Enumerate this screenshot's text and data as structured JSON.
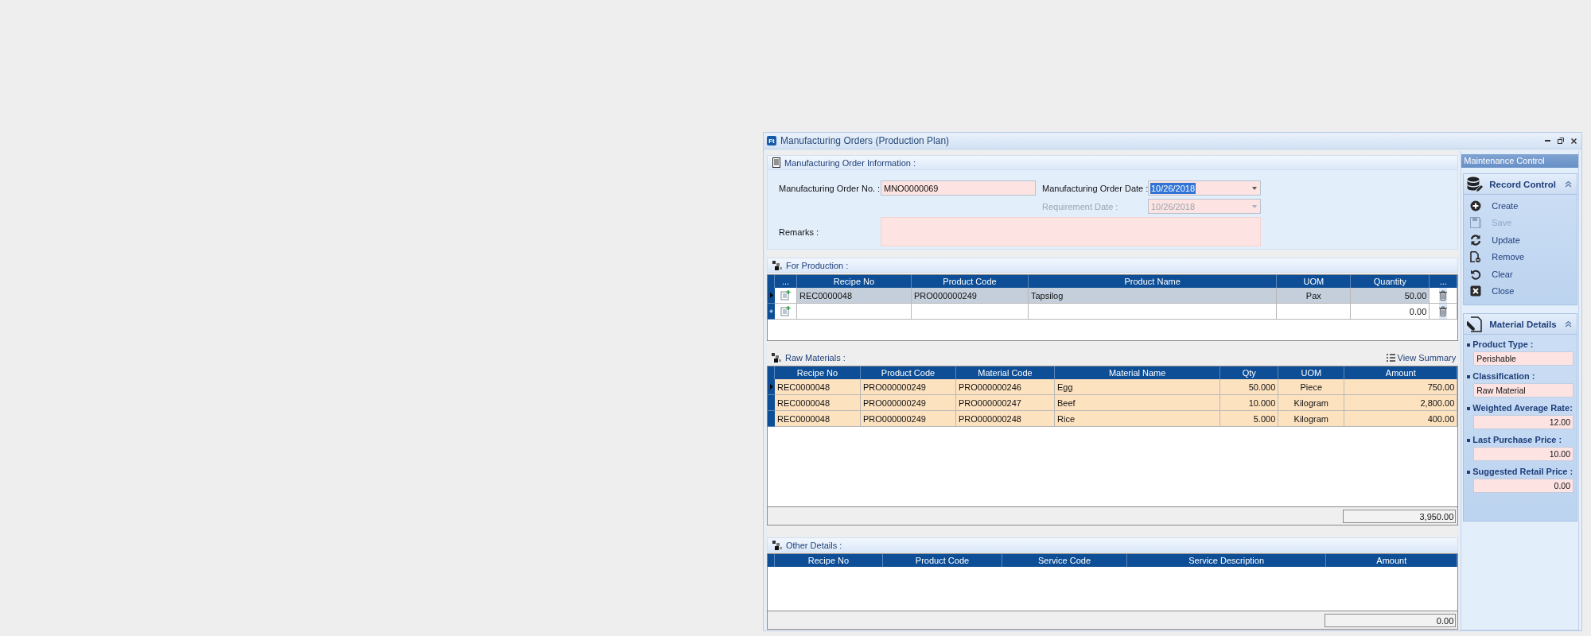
{
  "window": {
    "app_icon": "Ft",
    "title": "Manufacturing Orders (Production Plan)"
  },
  "order_info": {
    "title": "Manufacturing Order Information :",
    "order_no": {
      "label": "Manufacturing Order No. :",
      "value": "MNO0000069"
    },
    "order_date": {
      "label": "Manufacturing Order Date :",
      "value": "10/26/2018",
      "value_selected": true,
      "disabled": false
    },
    "requirement_date": {
      "label": "Requirement Date :",
      "value": "10/26/2018",
      "value_selected": false,
      "disabled": true
    },
    "remarks": {
      "label": "Remarks :"
    }
  },
  "for_production": {
    "title": "For Production :",
    "columns": [
      "...",
      "Recipe No",
      "Product Code",
      "Product Name",
      "UOM",
      "Quantity",
      "..."
    ],
    "rows": [
      {
        "kind": "record",
        "selected": true,
        "recipe_no": "REC0000048",
        "product_code": "PRO000000249",
        "product_name": "Tapsilog",
        "uom": "Pax",
        "quantity": "50.00"
      },
      {
        "kind": "new",
        "selected": false,
        "quantity": "0.00"
      }
    ]
  },
  "raw_materials": {
    "title": "Raw Materials :",
    "view_summary": "View Summary",
    "columns": [
      "Recipe No",
      "Product Code",
      "Material Code",
      "Material Name",
      "Qty",
      "UOM",
      "Amount"
    ],
    "rows": [
      {
        "selected": true,
        "recipe_no": "REC0000048",
        "product_code": "PRO000000249",
        "material_code": "PRO000000246",
        "material_name": "Egg",
        "qty": "50.000",
        "uom": "Piece",
        "amount": "750.00"
      },
      {
        "selected": false,
        "recipe_no": "REC0000048",
        "product_code": "PRO000000249",
        "material_code": "PRO000000247",
        "material_name": "Beef",
        "qty": "10.000",
        "uom": "Kilogram",
        "amount": "2,800.00"
      },
      {
        "selected": false,
        "recipe_no": "REC0000048",
        "product_code": "PRO000000249",
        "material_code": "PRO000000248",
        "material_name": "Rice",
        "qty": "5.000",
        "uom": "Kilogram",
        "amount": "400.00"
      }
    ],
    "total": "3,950.00"
  },
  "other_details": {
    "title": "Other Details :",
    "columns": [
      "Recipe No",
      "Product Code",
      "Service Code",
      "Service Description",
      "Amount"
    ],
    "total": "0.00"
  },
  "side_panel": {
    "title": "Maintenance Control",
    "record_control": {
      "title": "Record Control",
      "expanded": true,
      "items": [
        {
          "label": "Create",
          "disabled": false
        },
        {
          "label": "Save",
          "disabled": true
        },
        {
          "label": "Update",
          "disabled": false
        },
        {
          "label": "Remove",
          "disabled": false
        },
        {
          "label": "Clear",
          "disabled": false
        },
        {
          "label": "Close",
          "disabled": false
        }
      ]
    },
    "material_details": {
      "title": "Material Details",
      "expanded": true,
      "fields": [
        {
          "kind": "text",
          "label": "Product Type :",
          "value": "Perishable"
        },
        {
          "kind": "text",
          "label": "Classification :",
          "value": "Raw Material"
        },
        {
          "kind": "number",
          "label": "Weighted Average Rate:",
          "value": "12.00"
        },
        {
          "kind": "number",
          "label": "Last Purchase Price :",
          "value": "10.00"
        },
        {
          "kind": "number",
          "label": "Suggested Retail Price :",
          "value": "0.00"
        }
      ]
    }
  }
}
